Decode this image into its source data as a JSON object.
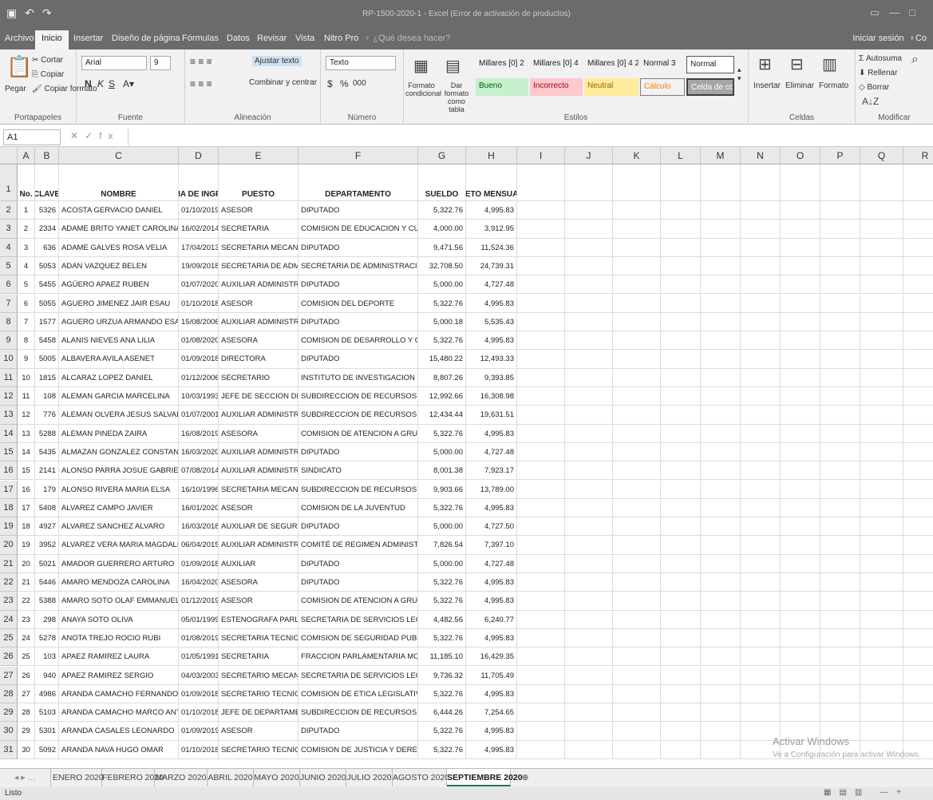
{
  "window": {
    "title": "RP-1500-2020-1 - Excel (Error de activación de productos)",
    "qat_icons": [
      "save-icon",
      "undo-icon",
      "redo-icon"
    ]
  },
  "ribbon_tabs": [
    "Archivo",
    "Inicio",
    "Insertar",
    "Diseño de página",
    "Fórmulas",
    "Datos",
    "Revisar",
    "Vista",
    "Nitro Pro",
    "♀ ¿Qué desea hacer?"
  ],
  "signin": "Iniciar sesión",
  "share_partial": "Co",
  "clipboard": {
    "paste": "Pegar",
    "cut": "Cortar",
    "copy": "Copiar",
    "format_painter": "Copiar formato",
    "label": "Portapapeles"
  },
  "font": {
    "name": "Arial",
    "size": "9",
    "bold": "N",
    "italic": "K",
    "underline": "S",
    "label": "Fuente"
  },
  "alignment": {
    "wrap": "Ajustar texto",
    "merge": "Combinar y centrar",
    "label": "Alineación"
  },
  "number": {
    "format": "Texto",
    "currency": "$",
    "percent": "%",
    "thousands": "000",
    "label": "Número"
  },
  "styles": {
    "conditional": "Formato condicional",
    "table": "Dar formato como tabla",
    "row1": [
      "Millares [0] 2",
      "Millares [0] 4",
      "Millares [0] 4 2",
      "Normal 3",
      "Normal"
    ],
    "row2": [
      "Bueno",
      "Incorrecto",
      "Neutral",
      "Cálculo",
      "Celda de co..."
    ],
    "label": "Estilos"
  },
  "cells_group": {
    "insert": "Insertar",
    "delete": "Eliminar",
    "format": "Formato",
    "label": "Celdas"
  },
  "editing": {
    "autosum": "Autosuma",
    "fill": "Rellenar",
    "clear": "Borrar",
    "sort": "Ordenar y filtrar",
    "find": "Buscar y seleccionar",
    "label": "Modificar"
  },
  "formula_bar": {
    "name_box": "A1",
    "fx": "fx",
    "content": ""
  },
  "columns": [
    "A",
    "B",
    "C",
    "D",
    "E",
    "F",
    "G",
    "H",
    "I",
    "J",
    "K",
    "L",
    "M",
    "N",
    "O",
    "P",
    "Q",
    "R"
  ],
  "headers": {
    "no": "No.",
    "clave": "CLAVE",
    "nombre": "NOMBRE",
    "fecha": "FECHA DE INGRESO",
    "puesto": "PUESTO",
    "depto": "DEPARTAMENTO",
    "sueldo": "SUELDO",
    "neto": "NETO MENSUAL"
  },
  "rows": [
    [
      "1",
      "5326",
      "ACOSTA GERVACIO DANIEL",
      "01/10/2019",
      "ASESOR",
      "DIPUTADO",
      "5,322.76",
      "4,995.83"
    ],
    [
      "2",
      "2334",
      "ADAME BRITO YANET CAROLINA",
      "16/02/2014",
      "SECRETARIA",
      "COMISION DE EDUCACION Y CULTURA",
      "4,000.00",
      "3,912.95"
    ],
    [
      "3",
      "636",
      "ADAME GALVES ROSA VELIA",
      "17/04/2013",
      "SECRETARIA MECANOGRAF",
      "DIPUTADO",
      "9,471.56",
      "11,524.36"
    ],
    [
      "4",
      "5053",
      "ADAN VAZQUEZ BELEN",
      "19/09/2018",
      "SECRETARIA DE ADMINISTR",
      "SECRETARIA DE ADMINISTRACION Y F",
      "32,708.50",
      "24,739.31"
    ],
    [
      "5",
      "5455",
      "AGÜERO APAEZ RUBEN",
      "01/07/2020",
      "AUXILIAR ADMINISTRATIVO",
      "DIPUTADO",
      "5,000.00",
      "4,727.48"
    ],
    [
      "6",
      "5055",
      "AGUERO JIMENEZ JAIR ESAU",
      "01/10/2018",
      "ASESOR",
      "COMISION DEL DEPORTE",
      "5,322.76",
      "4,995.83"
    ],
    [
      "7",
      "1577",
      "AGUERO URZUA ARMANDO ESAU",
      "15/08/2006",
      "AUXILIAR ADMINISTRATIVO",
      "DIPUTADO",
      "5,000.18",
      "5,535.43"
    ],
    [
      "8",
      "5458",
      "ALANIS NIEVES ANA LILIA",
      "01/08/2020",
      "ASESORA",
      "COMISION DE DESARROLLO Y CONFL",
      "5,322.76",
      "4,995.83"
    ],
    [
      "9",
      "5005",
      "ALBAVERA AVILA ASENET",
      "01/09/2018",
      "DIRECTORA",
      "DIPUTADO",
      "15,480.22",
      "12,493.33"
    ],
    [
      "10",
      "1815",
      "ALCARAZ LOPEZ DANIEL",
      "01/12/2006",
      "SECRETARIO",
      "INSTITUTO DE INVESTIGACION LEGISL",
      "8,807.26",
      "9,393.85"
    ],
    [
      "11",
      "108",
      "ALEMAN GARCIA MARCELINA",
      "10/03/1993",
      "JEFE DE SECCION DE INTEN",
      "SUBDIRECCION DE RECURSOS MATE",
      "12,992.66",
      "16,308.98"
    ],
    [
      "12",
      "776",
      "ALEMAN OLVERA JESUS SALVADOR",
      "01/07/2001",
      "AUXILIAR ADMINISTRATIVO",
      "SUBDIRECCION DE RECURSOS MATE",
      "12,434.44",
      "19,631.51"
    ],
    [
      "13",
      "5288",
      "ALEMAN PINEDA ZAIRA",
      "16/08/2019",
      "ASESORA",
      "COMISION DE ATENCION A GRUPOS V",
      "5,322.76",
      "4,995.83"
    ],
    [
      "14",
      "5435",
      "ALMAZAN GONZALEZ CONSTANZA",
      "16/03/2020",
      "AUXILIAR ADMINISTRATIVO",
      "DIPUTADO",
      "5,000.00",
      "4,727.48"
    ],
    [
      "15",
      "2141",
      "ALONSO PARRA JOSUE GABRIEL",
      "07/08/2014",
      "AUXILIAR ADMINISTRATIVO",
      "SINDICATO",
      "8,001.38",
      "7,923.17"
    ],
    [
      "16",
      "179",
      "ALONSO RIVERA MARIA ELSA",
      "16/10/1996",
      "SECRETARIA MECANOGRAF",
      "SUBDIRECCION DE RECURSOS MATE",
      "9,903.66",
      "13,789.00"
    ],
    [
      "17",
      "5408",
      "ALVAREZ CAMPO JAVIER",
      "16/01/2020",
      "ASESOR",
      "COMISION DE LA JUVENTUD",
      "5,322.76",
      "4,995.83"
    ],
    [
      "18",
      "4927",
      "ALVAREZ SANCHEZ ALVARO",
      "16/03/2018",
      "AUXILIAR DE SEGURIDAD",
      "DIPUTADO",
      "5,000.00",
      "4,727.50"
    ],
    [
      "19",
      "3952",
      "ALVAREZ VERA MARIA MAGDALENA",
      "06/04/2015",
      "AUXILIAR ADMINISTRATIVO",
      "COMITÉ DE REGIMEN ADMINISTRATIVO",
      "7,826.54",
      "7,397.10"
    ],
    [
      "20",
      "5021",
      "AMADOR GUERRERO ARTURO",
      "01/09/2018",
      "AUXILIAR",
      "DIPUTADO",
      "5,000.00",
      "4,727.48"
    ],
    [
      "21",
      "5446",
      "AMARO MENDOZA CAROLINA",
      "16/04/2020",
      "ASESORA",
      "DIPUTADO",
      "5,322.76",
      "4,995.83"
    ],
    [
      "22",
      "5388",
      "AMARO SOTO OLAF EMMANUEL",
      "01/12/2019",
      "ASESOR",
      "COMISION DE ATENCION A GRUPOS V",
      "5,322.76",
      "4,995.83"
    ],
    [
      "23",
      "298",
      "ANAYA SOTO OLIVA",
      "05/01/1999",
      "ESTENOGRAFA PARLAMENT",
      "SECRETARIA DE SERVICIOS LEGISLAT",
      "4,482.56",
      "6,240.77"
    ],
    [
      "24",
      "5278",
      "ANOTA TREJO ROCIO RUBI",
      "01/08/2019",
      "SECRETARIA TECNICA",
      "COMISION DE SEGURIDAD PUBLICA Y",
      "5,322.76",
      "4,995.83"
    ],
    [
      "25",
      "103",
      "APAEZ RAMIREZ LAURA",
      "01/05/1991",
      "SECRETARIA",
      "FRACCION PARLAMENTARIA MORENA",
      "11,185.10",
      "16,429.35"
    ],
    [
      "26",
      "940",
      "APAEZ RAMIREZ SERGIO",
      "04/03/2003",
      "SECRETARIO MECANOGRAF",
      "SECRETARIA DE SERVICIOS LEGISLAT",
      "9,736.32",
      "11,705.49"
    ],
    [
      "27",
      "4986",
      "ARANDA CAMACHO FERNANDO",
      "01/09/2018",
      "SECRETARIO TECNICO",
      "COMISION DE ETICA LEGISLATIVA",
      "5,322.76",
      "4,995.83"
    ],
    [
      "28",
      "5103",
      "ARANDA CAMACHO MARCO ANTONIO",
      "01/10/2018",
      "JEFE DE DEPARTAMENTO D",
      "SUBDIRECCION DE RECURSOS MATE",
      "6,444.26",
      "7,254.65"
    ],
    [
      "29",
      "5301",
      "ARANDA CASALES LEONARDO",
      "01/09/2019",
      "ASESOR",
      "DIPUTADO",
      "5,322.76",
      "4,995.83"
    ],
    [
      "30",
      "5092",
      "ARANDA NAVA HUGO OMAR",
      "01/10/2018",
      "SECRETARIO TECNICO",
      "COMISION DE JUSTICIA Y DERECHOS",
      "5,322.76",
      "4,995.83"
    ]
  ],
  "watermark": {
    "line1": "Activar Windows",
    "line2": "Ve a Configuración para activar Windows."
  },
  "sheet_tabs": [
    "ENERO 2020",
    "FEBRERO 2020",
    "MARZO 2020",
    "ABRIL 2020",
    "MAYO 2020",
    "JUNIO 2020",
    "JULIO 2020",
    "AGOSTO 2020",
    "SEPTIEMBRE 2020"
  ],
  "active_sheet": "SEPTIEMBRE 2020",
  "status": "Listo"
}
